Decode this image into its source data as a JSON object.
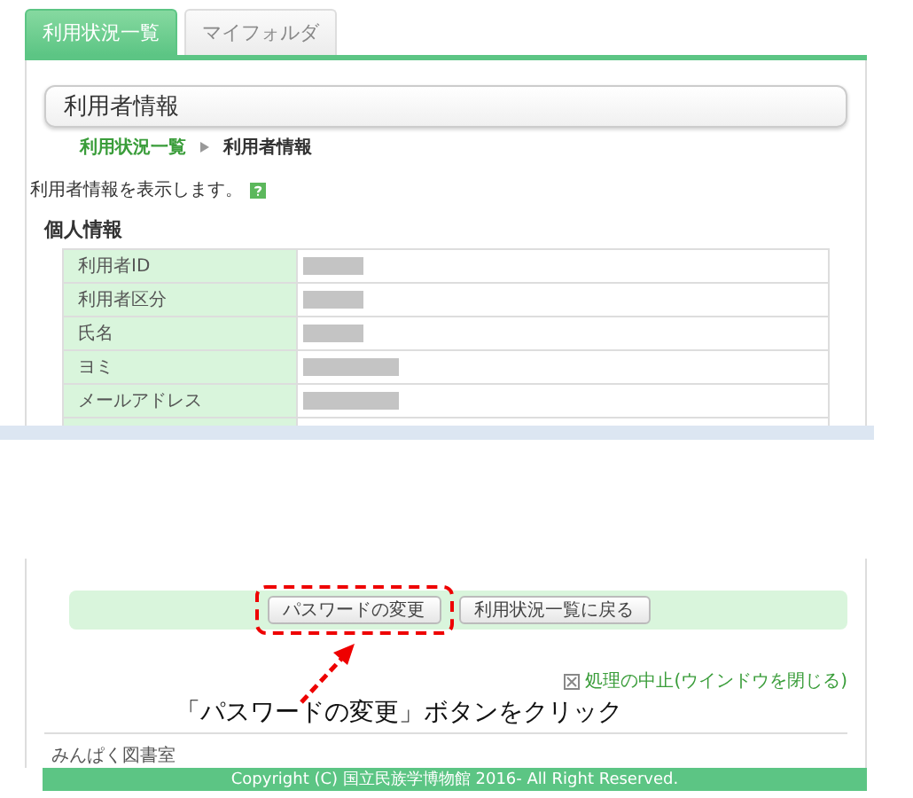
{
  "tabs": [
    {
      "label": "利用状況一覧",
      "selected": true
    },
    {
      "label": "マイフォルダ",
      "selected": false
    }
  ],
  "page_title": "利用者情報",
  "breadcrumb": [
    {
      "label": "利用状況一覧",
      "kind": "link"
    },
    {
      "label": "利用者情報",
      "kind": "current"
    }
  ],
  "description": "利用者情報を表示します。",
  "section_title": "個人情報",
  "rows": [
    {
      "label": "利用者ID"
    },
    {
      "label": "利用者区分"
    },
    {
      "label": "氏名"
    },
    {
      "label": "ヨミ"
    },
    {
      "label": "メールアドレス"
    },
    {}
  ],
  "buttons": [
    {
      "label": "パスワードの変更",
      "highlighted": true
    },
    {
      "label": "利用状況一覧に戻る",
      "highlighted": false
    }
  ],
  "close_link": "処理の中止(ウインドウを閉じる)",
  "annotation": "「パスワードの変更」ボタンをクリック",
  "site_name": "みんぱく図書室",
  "footer": "Copyright (C) 国立民族学博物館 2016- All Right Reserved."
}
